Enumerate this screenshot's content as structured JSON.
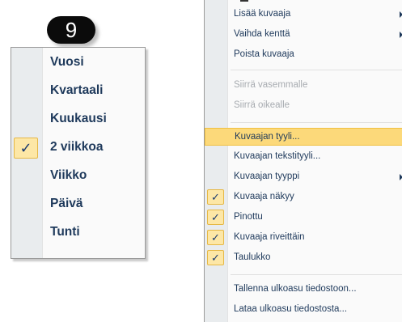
{
  "badge": {
    "number": "9"
  },
  "left_menu": {
    "items": [
      {
        "label": "Vuosi",
        "checked": false
      },
      {
        "label": "Kvartaali",
        "checked": false
      },
      {
        "label": "Kuukausi",
        "checked": false
      },
      {
        "label": "2 viikkoa",
        "checked": true
      },
      {
        "label": "Viikko",
        "checked": false
      },
      {
        "label": "Päivä",
        "checked": false
      },
      {
        "label": "Tunti",
        "checked": false
      }
    ],
    "check_glyph": "✓"
  },
  "right_menu": {
    "items": [
      {
        "label": "Lisää kuvaaja",
        "submenu": true
      },
      {
        "label": "Vaihda kenttä",
        "submenu": true
      },
      {
        "label": "Poista kuvaaja"
      },
      {
        "label": "Siirrä vasemmalle",
        "disabled": true
      },
      {
        "label": "Siirrä oikealle",
        "disabled": true
      },
      {
        "label": "Kuvaajan tyyli...",
        "highlighted": true
      },
      {
        "label": "Kuvaajan tekstityyli..."
      },
      {
        "label": "Kuvaajan tyyppi",
        "submenu": true
      },
      {
        "label": "Kuvaaja näkyy",
        "checked": true
      },
      {
        "label": "Pinottu",
        "checked": true
      },
      {
        "label": "Kuvaaja riveittäin",
        "checked": true
      },
      {
        "label": "Taulukko",
        "checked": true
      },
      {
        "label": "Tallenna ulkoasu tiedostoon..."
      },
      {
        "label": "Lataa ulkoasu tiedostosta..."
      }
    ],
    "check_glyph": "✓"
  },
  "colors": {
    "text": "#1e395b",
    "disabled_text": "#a7abb0",
    "highlight": "#fcd97a",
    "check_bg": "#fde7a6",
    "gutter": "#e9ecee"
  }
}
